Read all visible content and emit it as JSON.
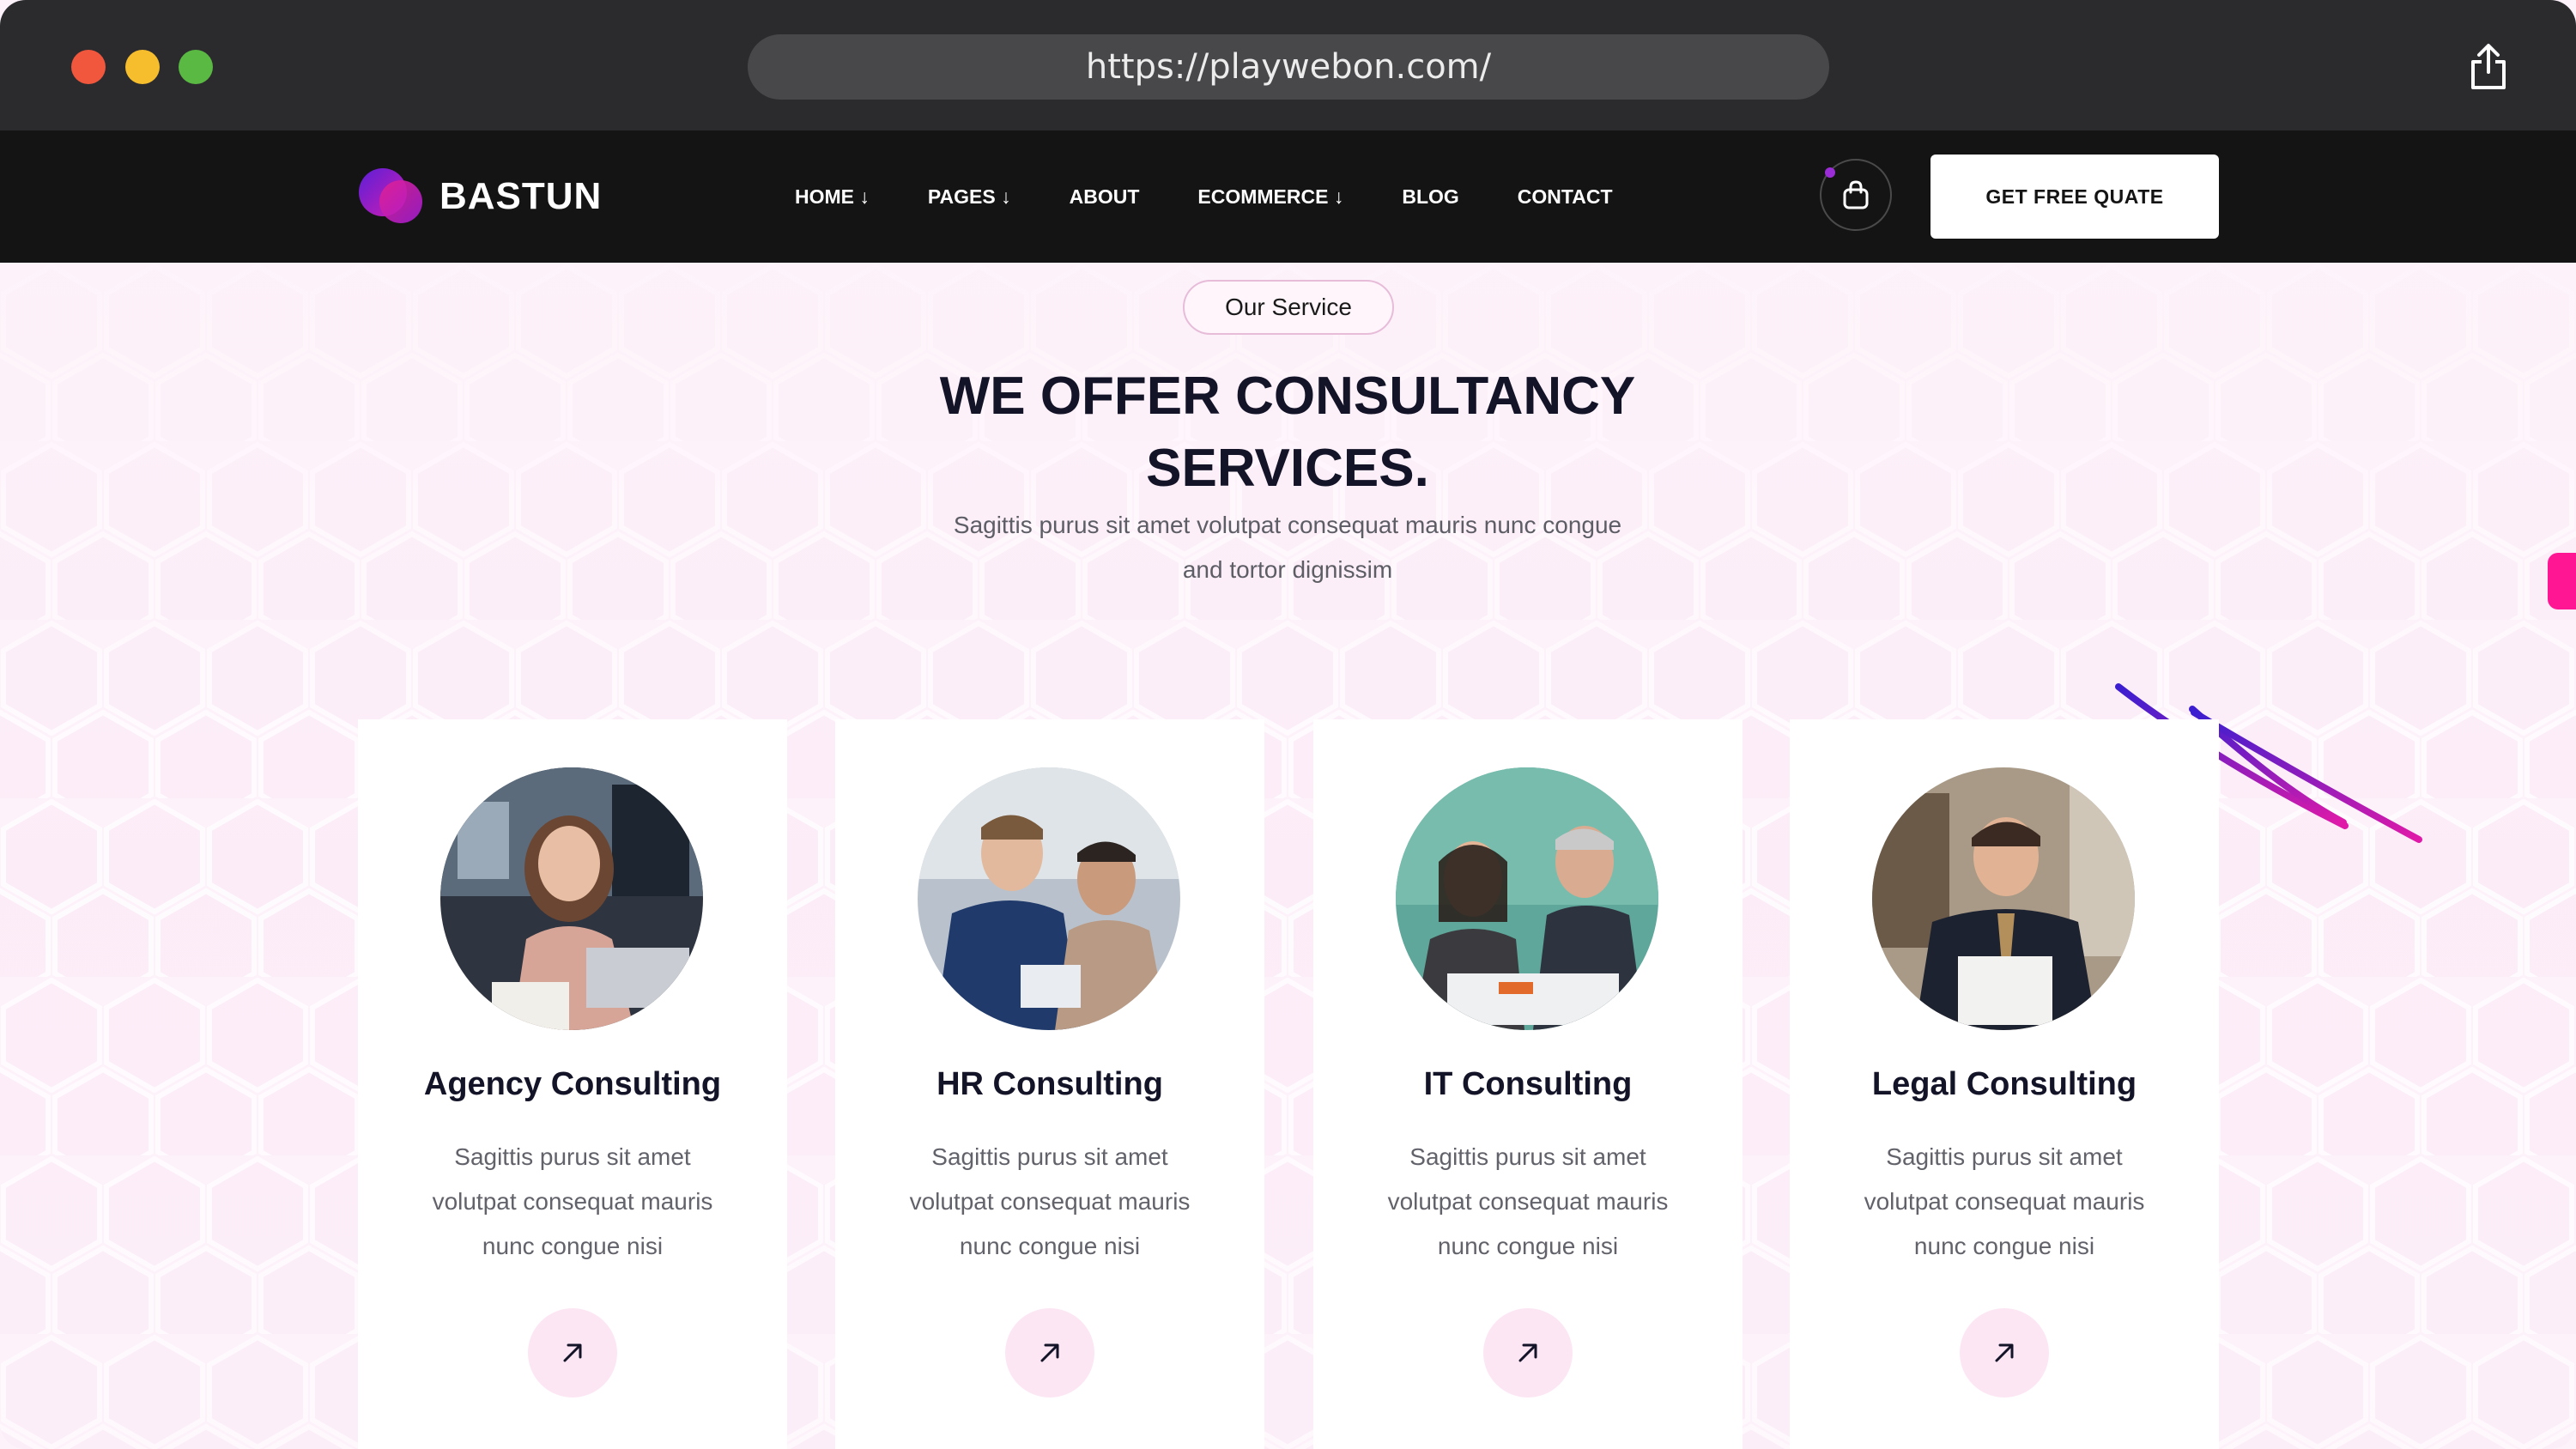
{
  "browser": {
    "url": "https://playwebon.com/"
  },
  "nav": {
    "logo_text": "BASTUN",
    "items": [
      {
        "label": "HOME ↓"
      },
      {
        "label": "PAGES ↓"
      },
      {
        "label": "ABOUT"
      },
      {
        "label": "ECOMMERCE ↓"
      },
      {
        "label": "BLOG"
      },
      {
        "label": "CONTACT"
      }
    ],
    "cart_icon": "shopping-bag-icon",
    "cta_label": "GET FREE QUATE"
  },
  "section": {
    "tag": "Our Service",
    "heading_line1": "WE OFFER CONSULTANCY",
    "heading_line2": "SERVICES.",
    "subtext_line1": "Sagittis purus sit amet volutpat consequat mauris nunc congue",
    "subtext_line2": "and tortor dignissim"
  },
  "cards": [
    {
      "title": "Agency Consulting",
      "text_line1": "Sagittis purus sit amet",
      "text_line2": "volutpat consequat mauris",
      "text_line3": "nunc congue nisi",
      "icon": "arrow-up-right-icon"
    },
    {
      "title": "HR Consulting",
      "text_line1": "Sagittis purus sit amet",
      "text_line2": "volutpat consequat mauris",
      "text_line3": "nunc congue nisi",
      "icon": "arrow-up-right-icon"
    },
    {
      "title": "IT Consulting",
      "text_line1": "Sagittis purus sit amet",
      "text_line2": "volutpat consequat mauris",
      "text_line3": "nunc congue nisi",
      "icon": "arrow-up-right-icon"
    },
    {
      "title": "Legal Consulting",
      "text_line1": "Sagittis purus sit amet",
      "text_line2": "volutpat consequat mauris",
      "text_line3": "nunc congue nisi",
      "icon": "arrow-up-right-icon"
    }
  ],
  "colors": {
    "accent_pink": "#ff1693",
    "accent_purple": "#5b1fd8",
    "nav_bg": "#141414",
    "page_bg": "#fdf2fa"
  }
}
